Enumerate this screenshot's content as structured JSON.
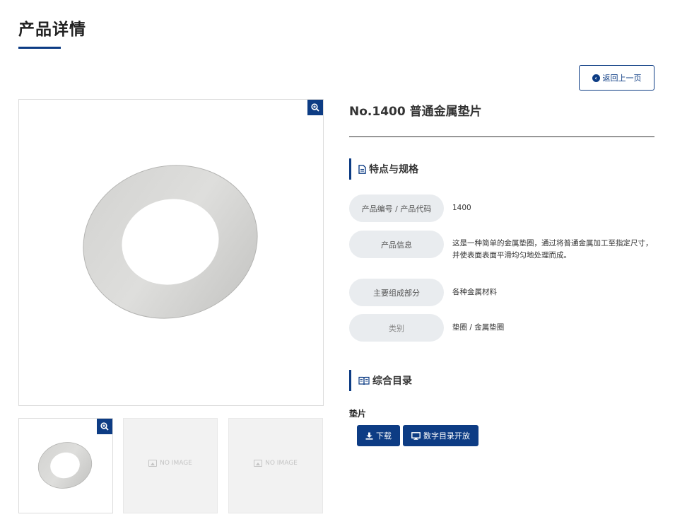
{
  "page": {
    "title": "产品详情"
  },
  "back_button": {
    "label": "返回上一页"
  },
  "gallery": {
    "no_image_label": "NO IMAGE"
  },
  "product": {
    "name": "No.1400 普通金属垫片"
  },
  "specs": {
    "heading": "特点与规格",
    "rows": [
      {
        "label": "产品编号 / 产品代码",
        "value": "1400"
      },
      {
        "label": "产品信息",
        "value": "这是一种简单的金属垫圈，通过将普通金属加工至指定尺寸，并使表面表面平滑均匀地处理而成。"
      },
      {
        "label": "主要组成部分",
        "value": "各种金属材料"
      },
      {
        "label": "类别",
        "value": "垫圈 / 金属垫圈"
      }
    ]
  },
  "catalog": {
    "heading": "综合目录",
    "item_label": "垫片",
    "download_label": "下载",
    "open_label": "数字目录开放"
  },
  "colors": {
    "accent": "#0d3c84",
    "label_bg": "#e9ecef"
  },
  "icons": [
    "arrow-left-circle-icon",
    "zoom-in-icon",
    "document-icon",
    "book-icon",
    "download-icon",
    "monitor-icon",
    "image-placeholder-icon"
  ]
}
